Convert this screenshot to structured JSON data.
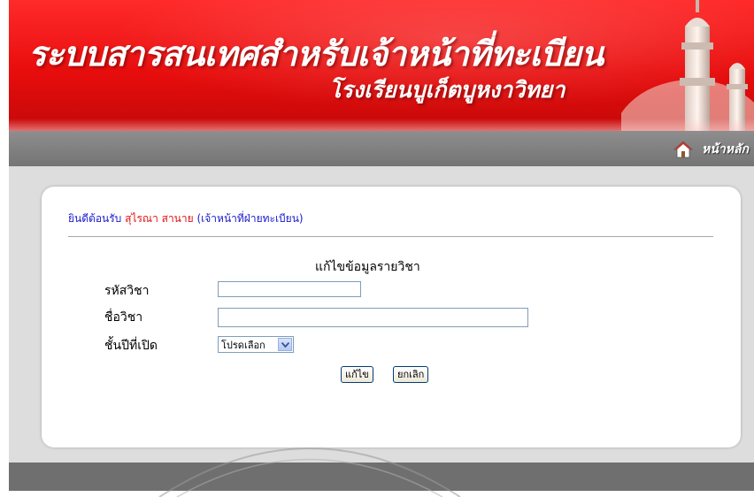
{
  "header": {
    "title": "ระบบสารสนเทศสำหรับเจ้าหน้าที่ทะเบียน",
    "subtitle": "โรงเรียนบูเก็ตบูหงาวิทยา"
  },
  "nav": {
    "home_label": "หน้าหลัก",
    "home_icon": "home-icon"
  },
  "welcome": {
    "prefix": "ยินดีต้อนรับ",
    "user_name": "สุไรณา สานาย",
    "role": "(เจ้าหน้าที่ฝ่ายทะเบียน)"
  },
  "form": {
    "title": "แก้ไขข้อมูลรายวิชา",
    "fields": [
      {
        "label": "รหัสวิชา",
        "value": ""
      },
      {
        "label": "ชื่อวิชา",
        "value": ""
      },
      {
        "label": "ชั้นปีที่เปิด",
        "selected": "โปรดเลือก"
      }
    ],
    "submit_label": "แก้ไข",
    "cancel_label": "ยกเลิก"
  },
  "colors": {
    "banner_red": "#e80d0d",
    "nav_grey": "#7f7f7f",
    "welcome_blue": "#1a1acc",
    "user_red": "#e01010"
  }
}
